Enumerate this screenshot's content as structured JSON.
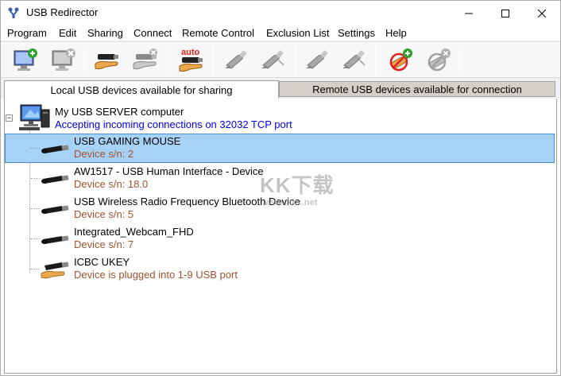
{
  "window": {
    "title": "USB Redirector"
  },
  "menu": [
    "Program",
    "Edit",
    "Sharing",
    "Connect",
    "Remote Control",
    "Exclusion List",
    "Settings",
    "Help"
  ],
  "toolbar": {
    "buttons": [
      {
        "icon": "add-server-icon"
      },
      {
        "icon": "remove-server-icon"
      },
      {
        "icon": "share-device-icon"
      },
      {
        "icon": "unshare-device-icon"
      },
      {
        "icon": "auto-share-icon",
        "label": "auto"
      },
      {
        "icon": "connect-device-icon"
      },
      {
        "icon": "disconnect-device-icon"
      },
      {
        "icon": "connect-all-icon"
      },
      {
        "icon": "disconnect-all-icon"
      },
      {
        "icon": "add-exclusion-icon"
      },
      {
        "icon": "remove-exclusion-icon"
      }
    ]
  },
  "tabs": {
    "local": "Local USB devices available for sharing",
    "remote": "Remote USB devices available for connection"
  },
  "server": {
    "title": "My USB SERVER computer",
    "status": "Accepting incoming connections on 32032 TCP port",
    "toggle": "−"
  },
  "devices": [
    {
      "name": "USB GAMING MOUSE",
      "detail": "Device s/n: 2",
      "selected": true
    },
    {
      "name": "AW1517 - USB Human Interface - Device",
      "detail": "Device s/n: 18.0",
      "selected": false
    },
    {
      "name": "USB Wireless Radio Frequency Bluetooth Device",
      "detail": "Device s/n: 5",
      "selected": false
    },
    {
      "name": "Integrated_Webcam_FHD",
      "detail": "Device s/n: 7",
      "selected": false
    },
    {
      "name": "ICBC UKEY",
      "detail": "Device is plugged into 1-9 USB port",
      "selected": false
    }
  ],
  "watermark": {
    "main": "KK下载",
    "url": "www.kkx.net"
  },
  "colors": {
    "selection": "#a6d2f5",
    "selection_border": "#4b8fcc",
    "status_link": "#0000e8",
    "device_detail": "#a0522d"
  }
}
